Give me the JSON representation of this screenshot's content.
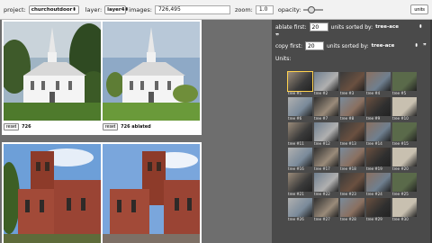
{
  "toolbar": {
    "project_label": "project:",
    "project_value": "churchoutdoor",
    "layer_label": "layer:",
    "layer_value": "layer4",
    "images_label": "images:",
    "images_value": "726,495",
    "zoom_label": "zoom:",
    "zoom_value": "1.0",
    "opacity_label": "opacity:",
    "opacity_level": 0.35,
    "units_button": "units"
  },
  "main": {
    "rows": [
      {
        "reset_label": "reset",
        "caption_left": "726",
        "caption_right": "726 ablated"
      }
    ]
  },
  "panel": {
    "ablate_label": "ablate first:",
    "ablate_value": "20",
    "ablate_suffix": "units sorted by:",
    "ablate_sort": "tree-ace",
    "copy_label": "copy first:",
    "copy_value": "20",
    "copy_suffix": "units sorted by:",
    "copy_sort": "tree-ace",
    "units_label": "Units:",
    "units": [
      "tree #1",
      "tree #2",
      "tree #3",
      "tree #4",
      "tree #5",
      "tree #6",
      "tree #7",
      "tree #8",
      "tree #9",
      "tree #10",
      "tree #11",
      "tree #12",
      "tree #13",
      "tree #14",
      "tree #15",
      "tree #16",
      "tree #17",
      "tree #18",
      "tree #19",
      "tree #20",
      "tree #21",
      "tree #22",
      "tree #23",
      "tree #24",
      "tree #25",
      "tree #26",
      "tree #27",
      "tree #28",
      "tree #29",
      "tree #30"
    ]
  }
}
